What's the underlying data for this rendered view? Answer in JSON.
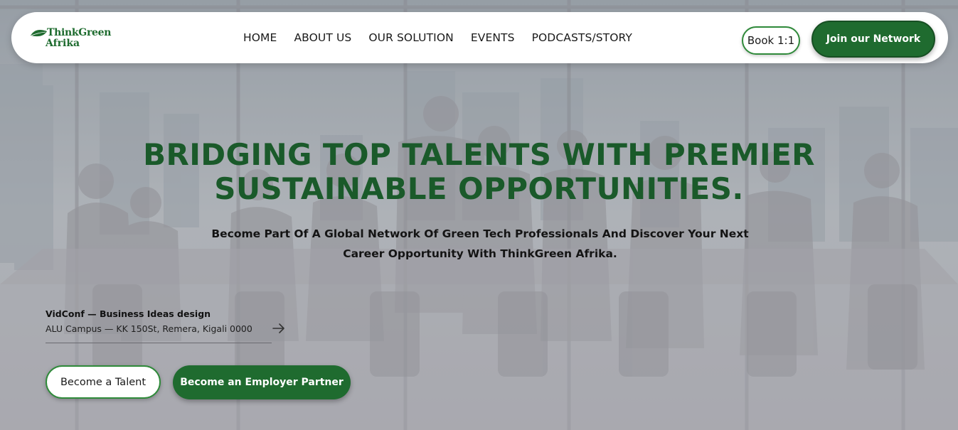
{
  "brand": {
    "logo_line1": "ThinkGreen",
    "logo_line2": "Afrika",
    "logo_icon": "leaf-icon",
    "primary_color": "#1f6b2f",
    "heading_color": "#1a5a2a"
  },
  "nav": {
    "items": [
      {
        "label": "HOME"
      },
      {
        "label": "ABOUT US"
      },
      {
        "label": "OUR SOLUTION"
      },
      {
        "label": "EVENTS"
      },
      {
        "label": "PODCASTS/STORY"
      }
    ],
    "book_label": "Book 1:1",
    "join_label": "Join our Network"
  },
  "hero": {
    "headline_line1": "BRIDGING TOP TALENTS WITH PREMIER",
    "headline_line2": "SUSTAINABLE OPPORTUNITIES.",
    "subtitle_line1": "Become Part Of A Global Network Of Green Tech Professionals And Discover Your Next",
    "subtitle_line2": "Career Opportunity With ThinkGreen Afrika."
  },
  "event": {
    "title": "VidConf — Business Ideas design",
    "location": "ALU Campus — KK 150St, Remera, Kigali 0000",
    "arrow_icon": "arrow-right-icon"
  },
  "cta": {
    "talent_label": "Become a Talent",
    "employer_label": "Become an Employer Partner"
  }
}
